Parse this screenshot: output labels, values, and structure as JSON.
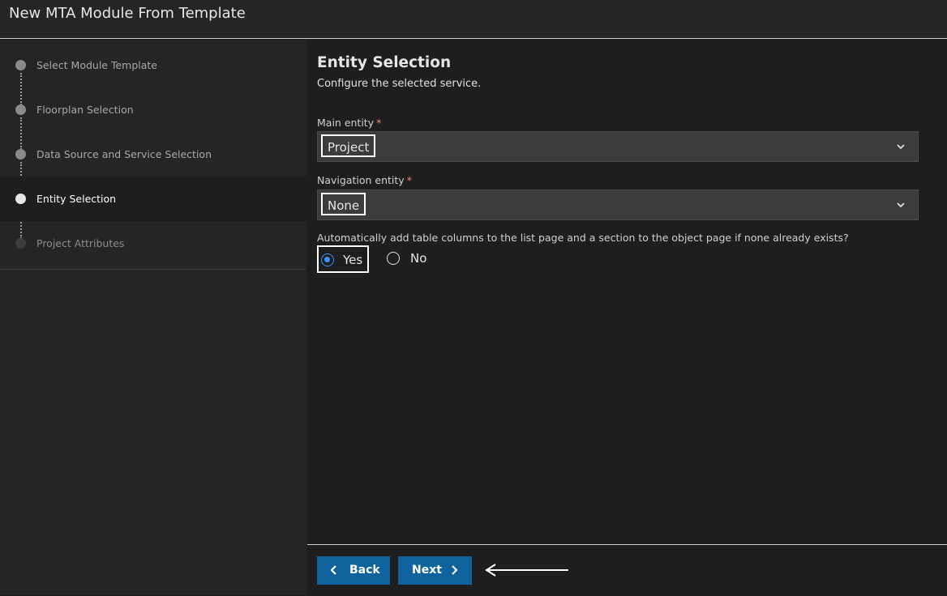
{
  "window": {
    "title": "New MTA Module From Template"
  },
  "sidebar": {
    "steps": [
      {
        "label": "Select Module Template",
        "state": "completed"
      },
      {
        "label": "Floorplan Selection",
        "state": "completed"
      },
      {
        "label": "Data Source and Service Selection",
        "state": "completed"
      },
      {
        "label": "Entity Selection",
        "state": "active"
      },
      {
        "label": "Project Attributes",
        "state": "pending"
      }
    ]
  },
  "main": {
    "heading": "Entity Selection",
    "subheading": "Configure the selected service.",
    "main_entity": {
      "label": "Main entity",
      "required_marker": "*",
      "value": "Project"
    },
    "navigation_entity": {
      "label": "Navigation entity",
      "required_marker": "*",
      "value": "None"
    },
    "auto_add": {
      "question": "Automatically add table columns to the list page and a section to the object page if none already exists?",
      "options": [
        "Yes",
        "No"
      ],
      "selected": "Yes"
    }
  },
  "footer": {
    "back_label": "Back",
    "next_label": "Next"
  },
  "colors": {
    "accent": "#0e639c",
    "radio_selected": "#3794ff",
    "required": "#f48771"
  },
  "icons": {
    "dropdown": "chevron-down-icon",
    "back": "chevron-left-icon",
    "next": "chevron-right-icon",
    "annotation": "arrow-left-icon"
  }
}
